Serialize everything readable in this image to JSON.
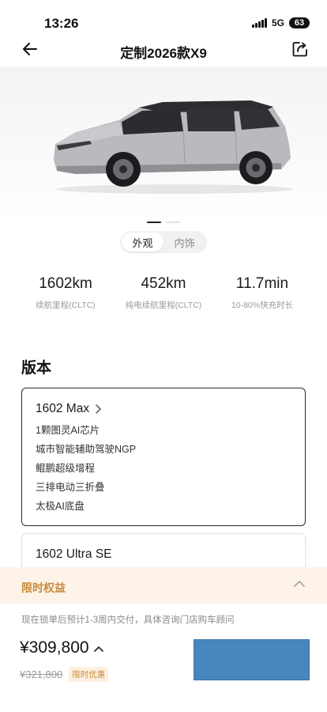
{
  "status_bar": {
    "time": "13:26",
    "network": "5G",
    "battery": "63"
  },
  "nav": {
    "title": "定制2026款X9",
    "back_icon": "back-arrow-icon",
    "share_icon": "share-icon"
  },
  "hero": {
    "image": "silver-mpv-car",
    "active_slide": 1,
    "slide_count": 2
  },
  "view_toggle": {
    "exterior": "外观",
    "interior": "内饰",
    "active": "exterior"
  },
  "stats": [
    {
      "value": "1602km",
      "label": "续航里程(CLTC)"
    },
    {
      "value": "452km",
      "label": "纯电续航里程(CLTC)"
    },
    {
      "value": "11.7min",
      "label": "10-80%快充时长"
    }
  ],
  "section": {
    "title": "版本"
  },
  "versions": [
    {
      "name": "1602 Max",
      "selected": true,
      "features": [
        "1颗图灵AI芯片",
        "城市智能辅助驾驶NGP",
        "鲲鹏超级增程",
        "三排电动三折叠",
        "太极AI底盘"
      ]
    },
    {
      "name": "1602 Ultra SE",
      "selected": false
    }
  ],
  "benefit": {
    "title": "限时权益",
    "toggle_icon": "chevron-up-icon"
  },
  "footer": {
    "delivery_note": "现在锁单后预计1-3周内交付，具体咨询门店购车顾问",
    "price": "¥309,800",
    "original_price": "¥321,800",
    "promo_badge": "限时优惠",
    "cta_color": "#4a86be"
  },
  "colors": {
    "accent_gold": "#c98a3c",
    "benefit_bg": "#fdf3e8",
    "cta": "#4a86be"
  }
}
